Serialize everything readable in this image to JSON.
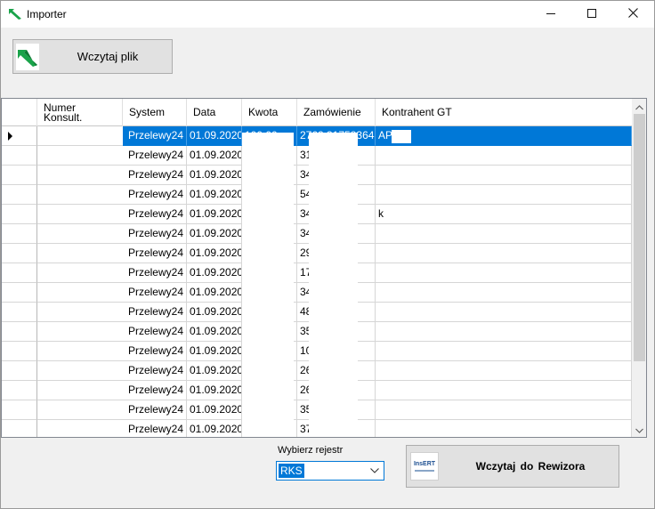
{
  "window": {
    "title": "Importer",
    "app_icon": "green-arrow-icon",
    "controls": [
      "minimize-icon",
      "maximize-icon",
      "close-icon"
    ]
  },
  "load_button": {
    "label": "Wczytaj plik",
    "icon": "green-arrow-icon"
  },
  "grid": {
    "columns": [
      "",
      "Numer\nKonsult.",
      "System",
      "Data",
      "Kwota",
      "Zamówienie",
      "Kontrahent GT"
    ],
    "rows": [
      {
        "numer": "",
        "system": "Przelewy24",
        "data": "01.09.2020",
        "kwota": "100,00",
        "zamowienie": "2762 317583643",
        "kontrahent": "AP"
      },
      {
        "numer": "",
        "system": "Przelewy24",
        "data": "01.09.2020",
        "kwota": "",
        "zamowienie": "31        031",
        "kontrahent": ""
      },
      {
        "numer": "",
        "system": "Przelewy24",
        "data": "01.09.2020",
        "kwota": "",
        "zamowienie": "34        331",
        "kontrahent": ""
      },
      {
        "numer": "",
        "system": "Przelewy24",
        "data": "01.09.2020",
        "kwota": "",
        "zamowienie": "54        298",
        "kontrahent": ""
      },
      {
        "numer": "",
        "system": "Przelewy24",
        "data": "01.09.2020",
        "kwota": "",
        "zamowienie": "34        290",
        "kontrahent": "k"
      },
      {
        "numer": "",
        "system": "Przelewy24",
        "data": "01.09.2020",
        "kwota": "",
        "zamowienie": "34        377",
        "kontrahent": ""
      },
      {
        "numer": "",
        "system": "Przelewy24",
        "data": "01.09.2020",
        "kwota": "",
        "zamowienie": "29        349",
        "kontrahent": ""
      },
      {
        "numer": "",
        "system": "Przelewy24",
        "data": "01.09.2020",
        "kwota": "",
        "zamowienie": "17        508",
        "kontrahent": ""
      },
      {
        "numer": "",
        "system": "Przelewy24",
        "data": "01.09.2020",
        "kwota": "",
        "zamowienie": "34        336",
        "kontrahent": ""
      },
      {
        "numer": "",
        "system": "Przelewy24",
        "data": "01.09.2020",
        "kwota": "",
        "zamowienie": "48        774",
        "kontrahent": ""
      },
      {
        "numer": "",
        "system": "Przelewy24",
        "data": "01.09.2020",
        "kwota": "",
        "zamowienie": "35        418",
        "kontrahent": ""
      },
      {
        "numer": "",
        "system": "Przelewy24",
        "data": "01.09.2020",
        "kwota": "",
        "zamowienie": "10        975",
        "kontrahent": ""
      },
      {
        "numer": "",
        "system": "Przelewy24",
        "data": "01.09.2020",
        "kwota": "",
        "zamowienie": "26        582",
        "kontrahent": ""
      },
      {
        "numer": "",
        "system": "Przelewy24",
        "data": "01.09.2020",
        "kwota": "",
        "zamowienie": "26        533",
        "kontrahent": ""
      },
      {
        "numer": "",
        "system": "Przelewy24",
        "data": "01.09.2020",
        "kwota": "",
        "zamowienie": "35        425",
        "kontrahent": ""
      },
      {
        "numer": "",
        "system": "Przelewy24",
        "data": "01.09.2020",
        "kwota": "",
        "zamowienie": "37        599",
        "kontrahent": ""
      }
    ],
    "selected_row": 0
  },
  "register": {
    "label": "Wybierz rejestr",
    "selected": "RKS"
  },
  "rewizor_button": {
    "label": "Wczytaj  do Rewizora",
    "logo_text": "InsERT"
  },
  "colors": {
    "selection": "#0078d7",
    "button_face": "#e1e1e1",
    "window_bg": "#f0f0f0"
  }
}
